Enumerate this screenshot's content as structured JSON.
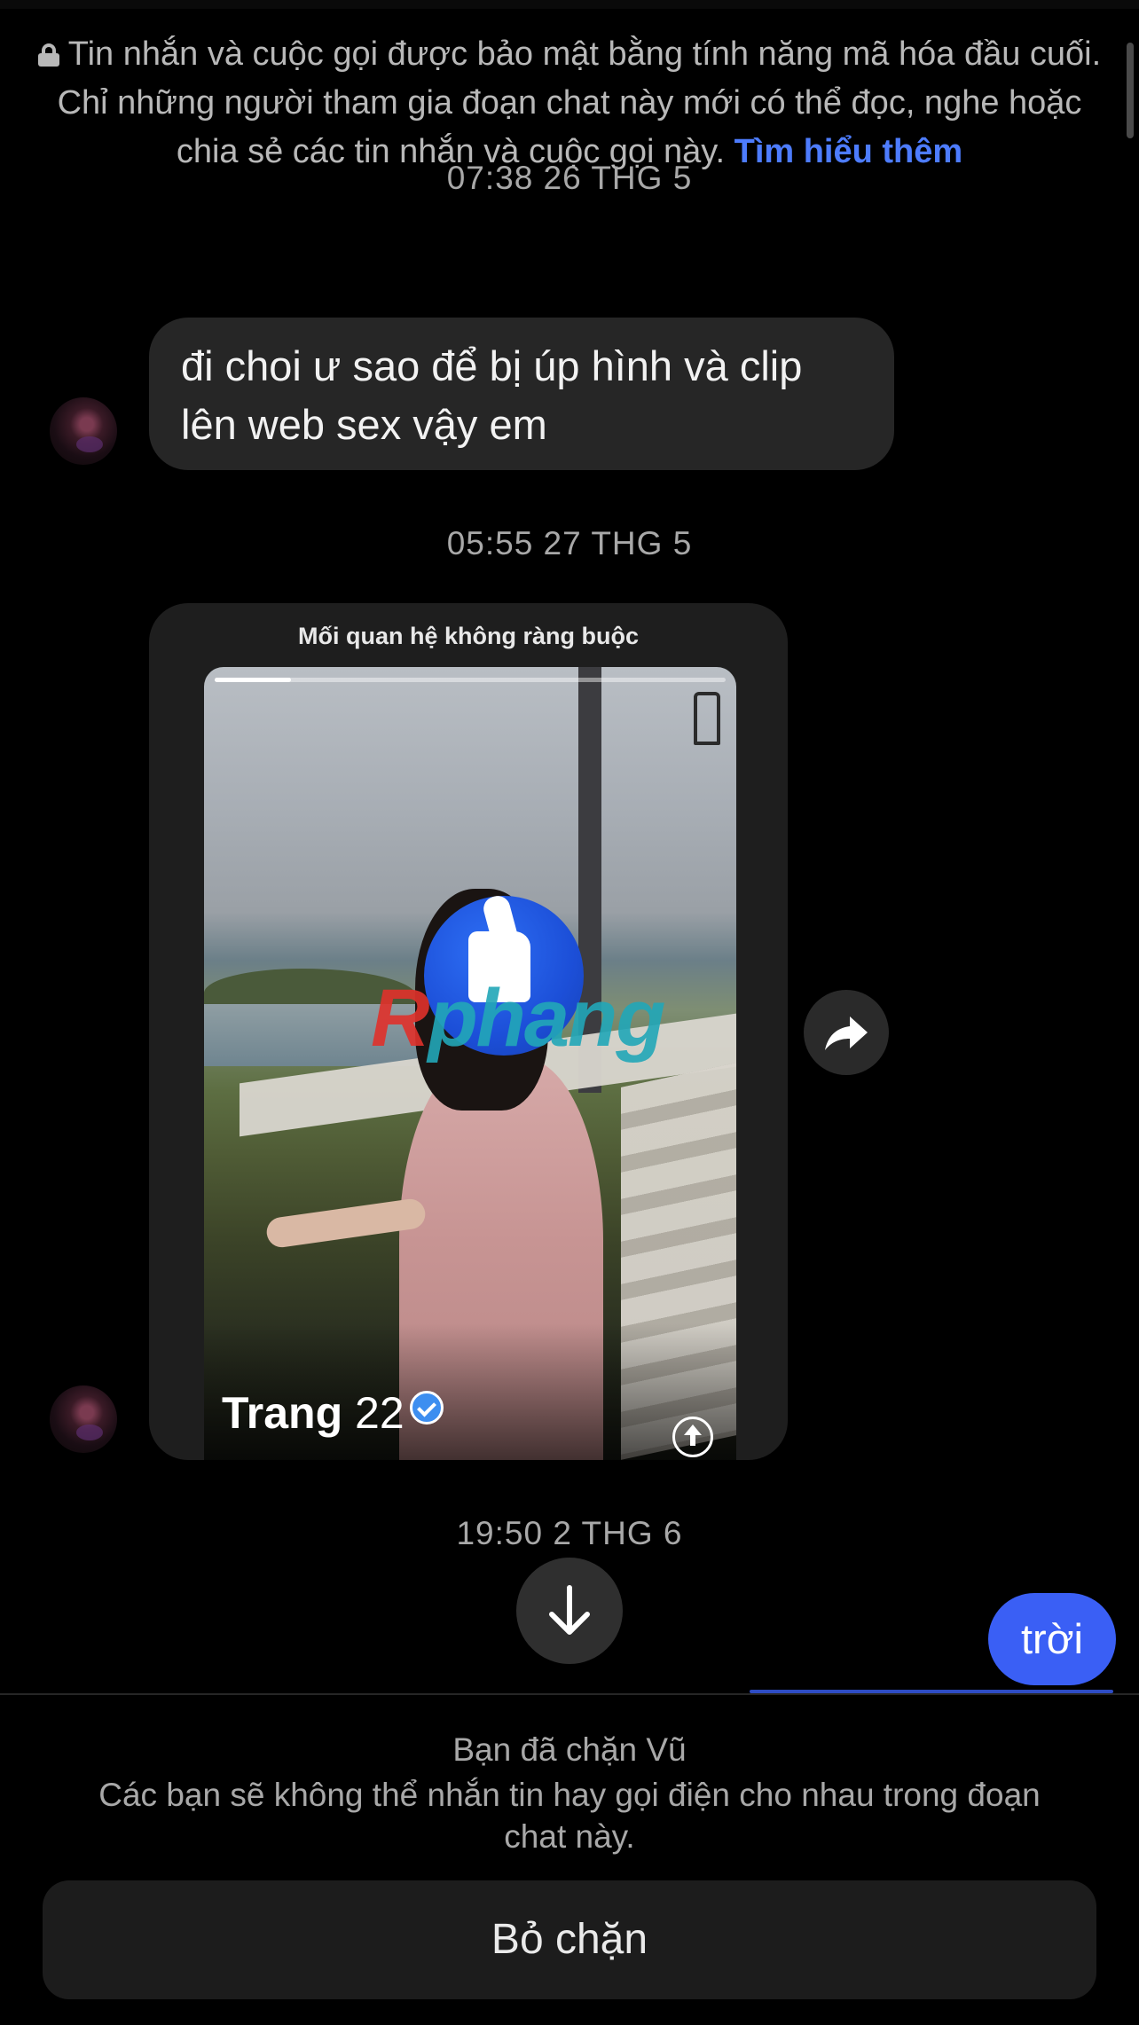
{
  "encryption_notice": {
    "text": "Tin nhắn và cuộc gọi được bảo mật bằng tính năng mã hóa đầu cuối. Chỉ những người tham gia đoạn chat này mới có thể đọc, nghe hoặc chia sẻ các tin nhắn và cuộc gọi này.",
    "learn_more": "Tìm hiểu thêm",
    "icon": "lock-icon"
  },
  "messages": [
    {
      "timestamp": "07:38 26 THG 5",
      "direction": "incoming",
      "text": "đi choi ư sao để bị úp hình và clip lên web sex vậy em"
    },
    {
      "timestamp": "05:55 27 THG 5",
      "direction": "incoming",
      "shared_post": {
        "caption": "Mối quan hệ không ràng buộc",
        "profile_name": "Trang",
        "profile_age": "22",
        "verified": true,
        "progress": 0.15,
        "watermark": "phang"
      }
    },
    {
      "timestamp": "19:50 2 THG 6",
      "direction": "outgoing",
      "text": "trời"
    }
  ],
  "block_panel": {
    "title": "Bạn đã chặn Vũ",
    "description": "Các bạn sẽ không thể nhắn tin hay gọi điện cho nhau trong đoạn chat này.",
    "unblock_label": "Bỏ chặn"
  },
  "colors": {
    "background": "#000000",
    "incoming_bubble": "#262626",
    "outgoing_bubble": "#3a5ff5",
    "link": "#4d7cfe"
  }
}
